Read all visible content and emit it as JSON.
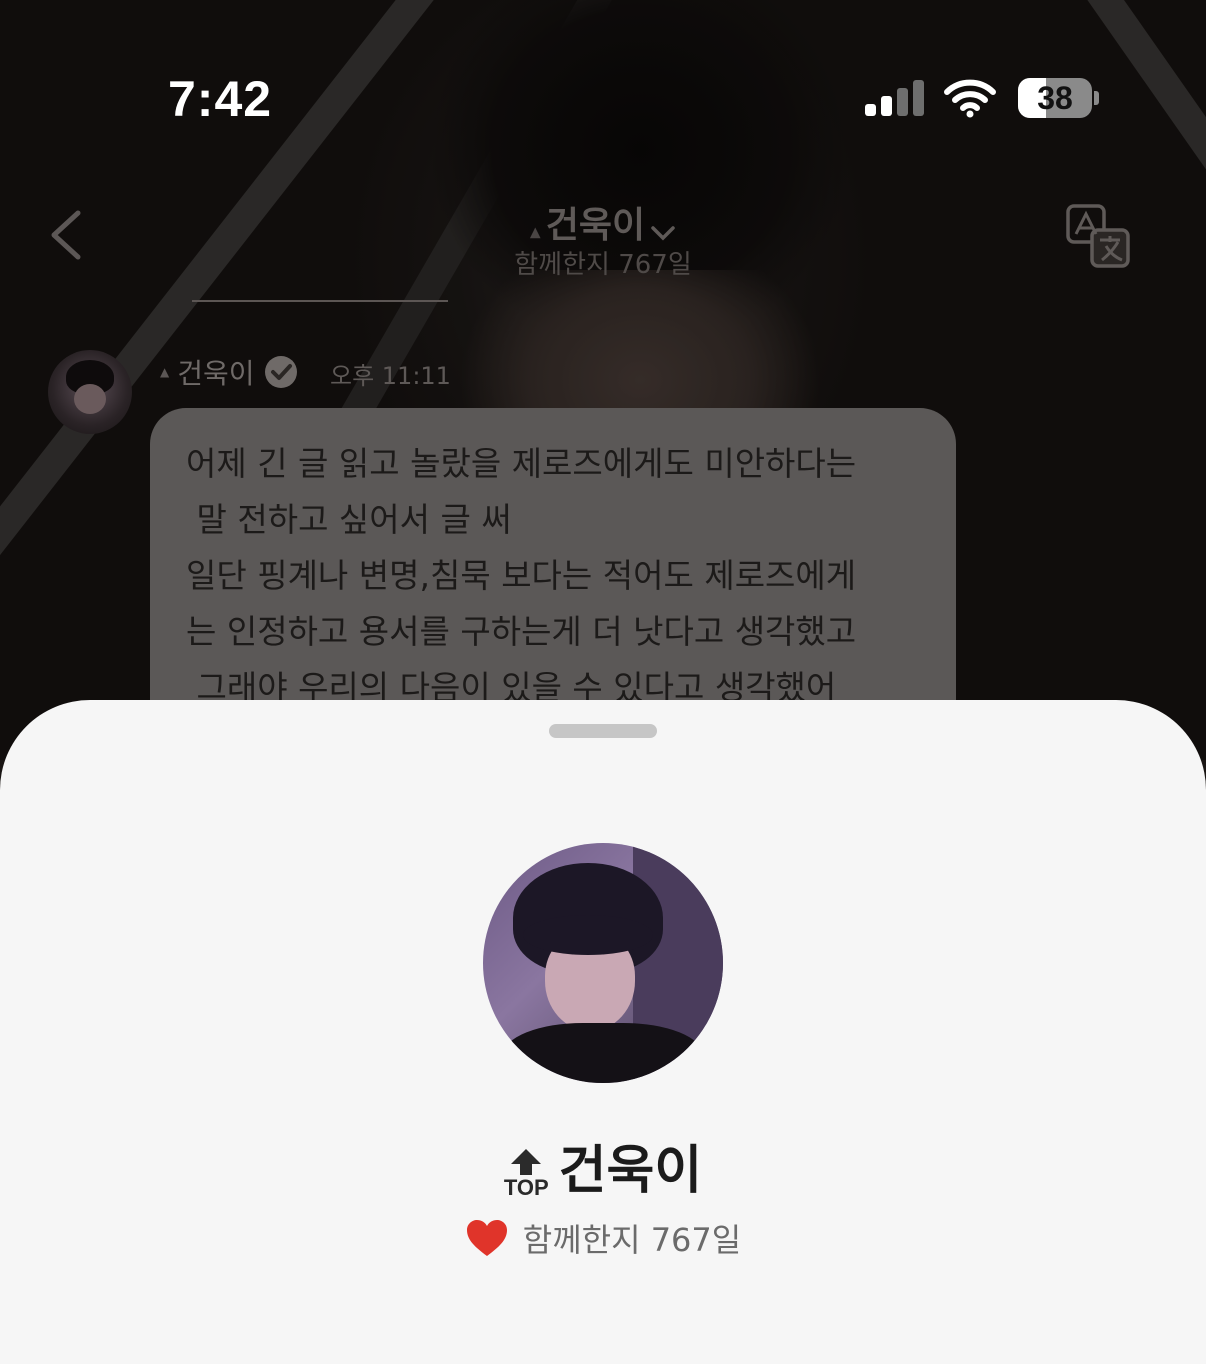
{
  "status_bar": {
    "time": "7:42",
    "battery": "38",
    "icons": [
      "cellular-signal-icon",
      "wifi-icon",
      "battery-icon"
    ]
  },
  "header": {
    "name": "건욱이",
    "days_together": "함께한지 767일",
    "icons": [
      "back-chevron-icon",
      "top-badge-icon",
      "dropdown-chevron-icon",
      "translate-icon"
    ]
  },
  "message": {
    "sender": "건욱이",
    "time": "오후 11:11",
    "text": "어제 긴 글 읽고 놀랐을 제로즈에게도 미안하다는\n 말 전하고 싶어서 글 써\n일단 핑계나 변명,침묵 보다는 적어도 제로즈에게\n는 인정하고 용서를 구하는게 더 낫다고 생각했고\n 그래야 우리의 다음이 있을 수 있다고 생각했어",
    "icons": [
      "verified-badge-icon",
      "top-badge-icon"
    ]
  },
  "profile_sheet": {
    "badge": "TOP",
    "name": "건욱이",
    "days_together": "함께한지 767일",
    "icons": [
      "top-arrow-icon",
      "heart-icon"
    ],
    "colors": {
      "heart": "#e0342a",
      "sheet_bg": "#f6f6f6"
    }
  }
}
